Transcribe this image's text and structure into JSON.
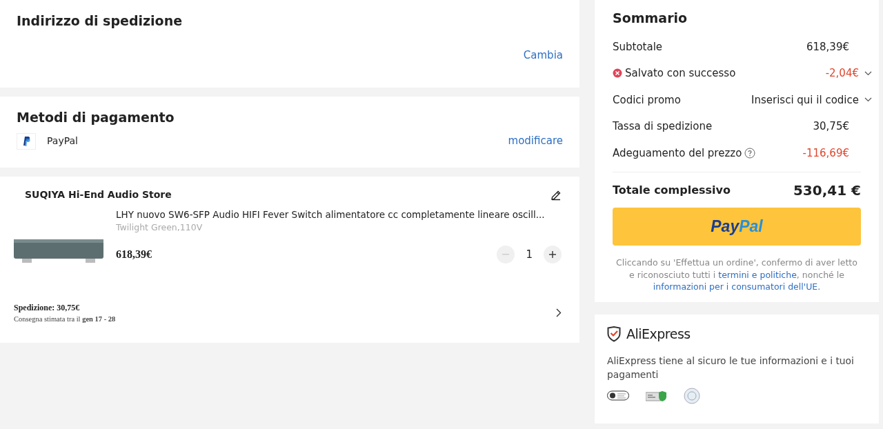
{
  "address": {
    "title": "Indirizzo di spedizione",
    "action": "Cambia"
  },
  "payment": {
    "title": "Metodi di pagamento",
    "method": "PayPal",
    "action": "modificare"
  },
  "store": {
    "name": "SUQIYA Hi-End Audio Store",
    "item": {
      "title": "LHY nuovo SW6-SFP Audio HIFI Fever Switch alimentatore cc completamente lineare oscill...",
      "variant": "Twilight Green,110V",
      "price": "618,39€",
      "quantity": "1",
      "minus_disabled": true
    },
    "shipping": {
      "fee": "Spedizione: 30,75€",
      "delivery": "Consegna stimata tra il **gen 17 - 28**"
    }
  },
  "summary": {
    "title": "Sommario",
    "rows": [
      {
        "kind": "plain",
        "label": "Subtotale",
        "value": "618,39€",
        "negative": false
      },
      {
        "kind": "saving",
        "label": "Salvato con successo",
        "value": "-2,04€",
        "negative": true
      },
      {
        "kind": "promo",
        "label": "Codici promo",
        "value": "Inserisci qui il codice",
        "negative": false
      },
      {
        "kind": "plain",
        "label": "Tassa di spedizione",
        "value": "30,75€",
        "negative": false
      },
      {
        "kind": "adjustment",
        "label": "Adeguamento del prezzo",
        "value": "-116,69€",
        "negative": true
      }
    ],
    "total_label": "Totale complessivo",
    "total": "530,41 €",
    "pay_button": {
      "pay": "Pay",
      "pal": "Pal"
    },
    "legal": [
      {
        "kind": "text",
        "text": "Cliccando su 'Effettua un ordine', confermo di aver letto e riconosciuto tutti i "
      },
      {
        "kind": "link",
        "text": "termini e politiche"
      },
      {
        "kind": "text",
        "text": ", nonché le "
      },
      {
        "kind": "link",
        "text": "informazioni per i consumatori dell'UE."
      }
    ]
  },
  "trust": {
    "brand": "AliExpress",
    "text": "AliExpress tiene al sicuro le tue informazioni e i tuoi pagamenti"
  }
}
